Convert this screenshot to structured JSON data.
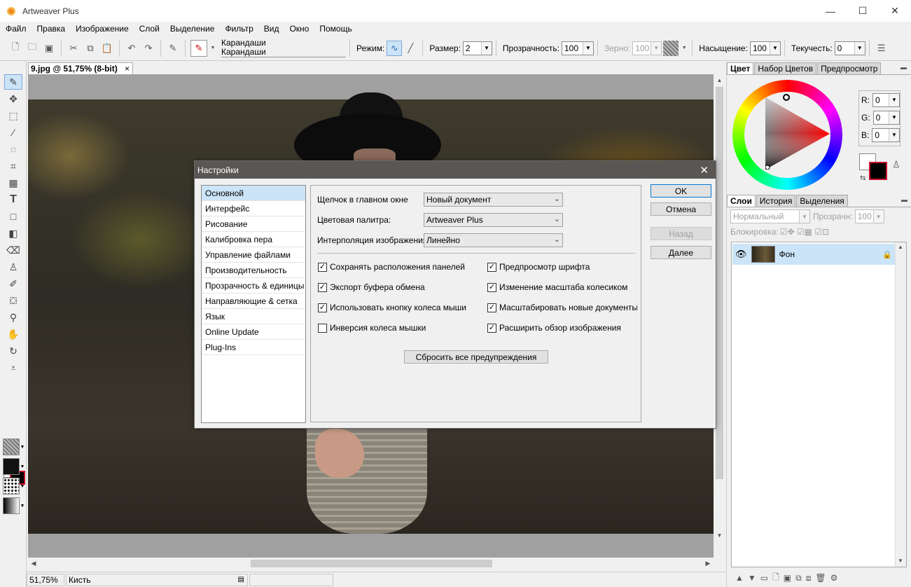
{
  "window": {
    "title": "Artweaver Plus",
    "controls": [
      "—",
      "☐",
      "✕"
    ]
  },
  "menu": [
    "Файл",
    "Правка",
    "Изображение",
    "Слой",
    "Выделение",
    "Фильтр",
    "Вид",
    "Окно",
    "Помощь"
  ],
  "toolbar": {
    "brush_category": "Карандаши",
    "brush_variant": "Карандаши",
    "mode_label": "Режим:",
    "size_label": "Размер:",
    "size_value": "2",
    "opacity_label": "Прозрачность:",
    "opacity_value": "100",
    "grain_label": "Зерно:",
    "grain_value": "100",
    "saturation_label": "Насыщение:",
    "saturation_value": "100",
    "flow_label": "Текучесть:",
    "flow_value": "0"
  },
  "document": {
    "tab_title": "9.jpg @ 51,75% (8-bit)",
    "close": "×"
  },
  "status": {
    "zoom": "51,75%",
    "tool": "Кисть"
  },
  "color_panel": {
    "tabs": [
      "Цвет",
      "Набор Цветов",
      "Предпросмотр"
    ],
    "r_label": "R:",
    "r_value": "0",
    "g_label": "G:",
    "g_value": "0",
    "b_label": "B:",
    "b_value": "0"
  },
  "layers_panel": {
    "tabs": [
      "Слои",
      "История",
      "Выделения"
    ],
    "blend_mode": "Нормальный",
    "opacity_label": "Прозрачн:",
    "opacity_value": "100",
    "lock_label": "Блокировка:",
    "layer_name": "Фон"
  },
  "dialog": {
    "title": "Настройки",
    "close": "✕",
    "nav": [
      "Основной",
      "Интерфейс",
      "Рисование",
      "Калибровка пера",
      "Управление файлами",
      "Производительность",
      "Прозрачность & единицы",
      "Направляющие & сетка",
      "Язык",
      "Online Update",
      "Plug-Ins"
    ],
    "settings": {
      "click_label": "Щелчок в главном окне",
      "click_value": "Новый документ",
      "palette_label": "Цветовая палитра:",
      "palette_value": "Artweaver Plus",
      "interp_label": "Интерполяция изображения",
      "interp_value": "Линейно"
    },
    "checkboxes_left": [
      {
        "label": "Сохранять расположения панелей",
        "checked": true
      },
      {
        "label": "Экспорт буфера обмена",
        "checked": true
      },
      {
        "label": "Использовать кнопку колеса мыши",
        "checked": true
      },
      {
        "label": "Инверсия колеса мышки",
        "checked": false
      }
    ],
    "checkboxes_right": [
      {
        "label": "Предпросмотр шрифта",
        "checked": true
      },
      {
        "label": "Изменение масштаба колесиком",
        "checked": true
      },
      {
        "label": "Масштабировать новые документы",
        "checked": true
      },
      {
        "label": "Расширить обзор изображения",
        "checked": true
      }
    ],
    "reset_button": "Сбросить все предупреждения",
    "ok_button": "OK",
    "cancel_button": "Отмена",
    "back_button": "Назад",
    "next_button": "Далее"
  }
}
